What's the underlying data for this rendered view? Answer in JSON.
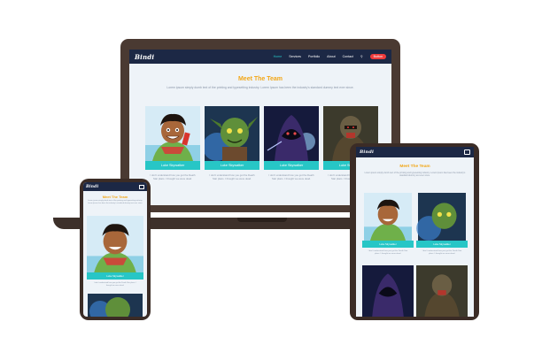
{
  "site": {
    "logo": "Bindi",
    "nav": [
      "Home",
      "Services",
      "Portfolio",
      "About",
      "Contact"
    ],
    "active_nav": "Home",
    "cta_label": "Button",
    "search_icon": "search-icon",
    "menu_icon": "hamburger-icon"
  },
  "team_section": {
    "title": "Meet The Team",
    "description": "Lorem ipsum simply dumb text of the printing and typesetting industry. Lorem Ipsum has been the industry's standard dummy text ever since.",
    "members": [
      {
        "name": "Luke Skywalker",
        "bio": "I don't understand how you got the Death Star plans. I thought we were dead."
      },
      {
        "name": "Luke Skywalker",
        "bio": "I don't understand how you got the Death Star plans. I thought we were dead."
      },
      {
        "name": "Luke Skywalker",
        "bio": "I don't understand how you got the Death Star plans. I thought we were dead."
      },
      {
        "name": "Luke Skywalker",
        "bio": "I don't understand how you got the Death Star plans. I thought we were dead."
      }
    ]
  },
  "colors": {
    "nav_bg": "#1c2845",
    "accent_teal": "#27c6c6",
    "title_orange": "#f2a718",
    "cta_red": "#ef3b3b",
    "device_frame": "#3b2c26"
  }
}
